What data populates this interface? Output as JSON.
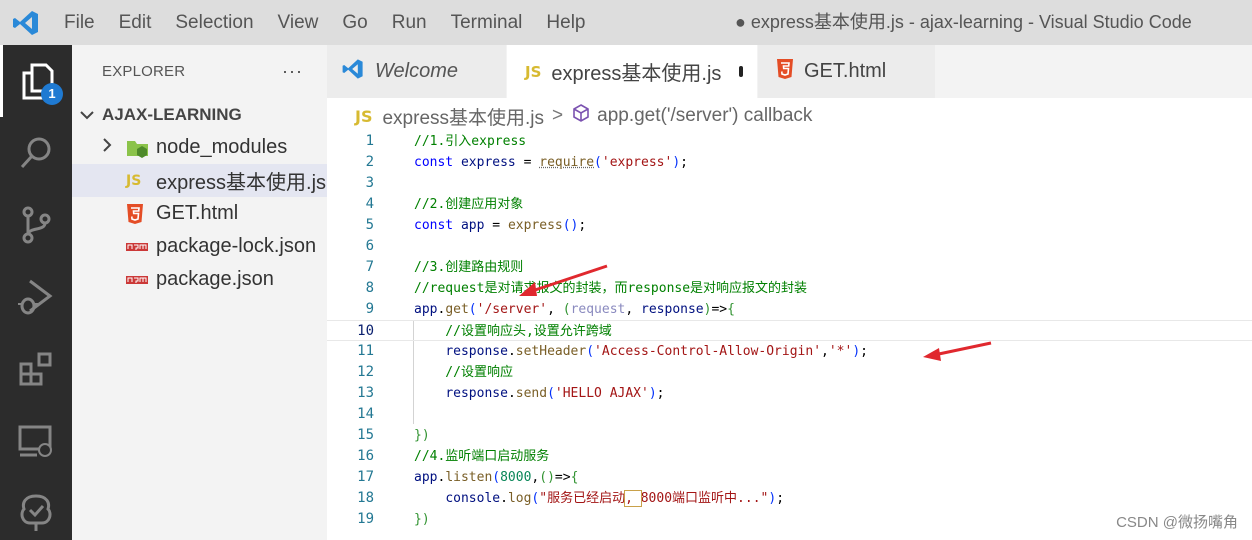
{
  "menu": [
    "File",
    "Edit",
    "Selection",
    "View",
    "Go",
    "Run",
    "Terminal",
    "Help"
  ],
  "window_title": "● express基本使用.js - ajax-learning - Visual Studio Code",
  "activity_bar": {
    "badge": "1",
    "icons": [
      "explorer-icon",
      "search-icon",
      "source-control-icon",
      "run-debug-icon",
      "extensions-icon",
      "remote-explorer-icon",
      "testing-icon"
    ]
  },
  "explorer": {
    "title": "EXPLORER",
    "more": "···",
    "folder": "AJAX-LEARNING",
    "items": [
      {
        "name": "node_modules",
        "type": "folder"
      },
      {
        "name": "express基本使用.js",
        "type": "js"
      },
      {
        "name": "GET.html",
        "type": "html"
      },
      {
        "name": "package-lock.json",
        "type": "npm"
      },
      {
        "name": "package.json",
        "type": "npm"
      }
    ]
  },
  "tabs": [
    {
      "label": "Welcome"
    },
    {
      "label": "express基本使用.js"
    },
    {
      "label": "GET.html"
    }
  ],
  "breadcrumb": {
    "js_tag": "JS",
    "file": "express基本使用.js",
    "separator": ">",
    "symbol": "app.get('/server') callback"
  },
  "code": {
    "line_numbers": [
      "1",
      "2",
      "3",
      "4",
      "5",
      "6",
      "7",
      "8",
      "9",
      "10",
      "11",
      "12",
      "13",
      "14",
      "15",
      "16",
      "17",
      "18",
      "19"
    ],
    "lines": [
      "//1.引入express",
      "const express = require('express');",
      "",
      "//2.创建应用对象",
      "const app = express();",
      "",
      "//3.创建路由规则",
      "//request是对请求报文的封装，而response是对响应报文的封装",
      "app.get('/server', (request, response)=>{",
      "    //设置响应头,设置允许跨域",
      "    response.setHeader('Access-Control-Allow-Origin','*');",
      "    //设置响应",
      "    response.send('HELLO AJAX');",
      "",
      "})",
      "//4.监听端口启动服务",
      "app.listen(8000,()=>{",
      "    console.log(\"服务已经启动, 8000端口监听中...\");",
      "})"
    ]
  },
  "watermark": "CSDN @微扬嘴角",
  "colors": {
    "accent": "#1f7ad2",
    "arrow": "#e0282e"
  }
}
